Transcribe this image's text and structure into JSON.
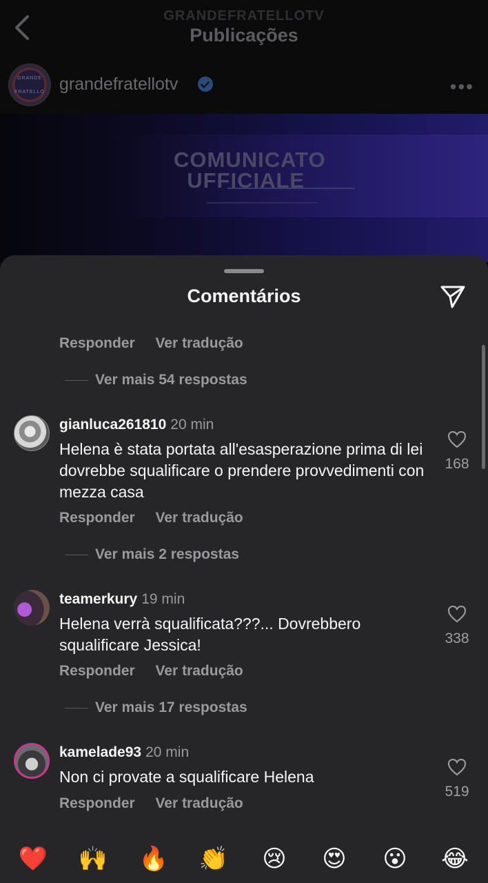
{
  "header": {
    "owner": "GRANDEFRATELLOTV",
    "title": "Publicações",
    "back_icon": "chevron-left-icon"
  },
  "post": {
    "username": "grandefratellotv",
    "avatar_text": "GRANDE FRATELLO",
    "banner_text": "COMUNICATO\nUFFICIALE"
  },
  "sheet": {
    "title": "Comentários"
  },
  "labels": {
    "reply": "Responder",
    "translate": "Ver tradução"
  },
  "top_partial": {
    "more_replies": "Ver mais 54 respostas"
  },
  "comments": [
    {
      "username": "gianluca261810",
      "time": "20 min",
      "text": "Helena è stata portata all'esasperazione prima di lei dovrebbe squalificare o prendere provvedimenti con mezza casa",
      "likes": "168",
      "more_replies": "Ver mais 2 respostas"
    },
    {
      "username": "teamerkury",
      "time": "19 min",
      "text": "Helena verrà squalificata???... Dovrebbero squalificare Jessica!",
      "likes": "338",
      "more_replies": "Ver mais 17 respostas"
    },
    {
      "username": "kamelade93",
      "time": "20 min",
      "text": "Non ci provate a squalificare Helena",
      "likes": "519"
    }
  ],
  "emojis": [
    "❤️",
    "🙌",
    "🔥",
    "👏",
    "😢",
    "😍",
    "😮",
    "😂"
  ],
  "colors": {
    "sheet_bg": "#262628",
    "text_primary": "#f5f5f5",
    "text_secondary": "#9a9a9e"
  }
}
